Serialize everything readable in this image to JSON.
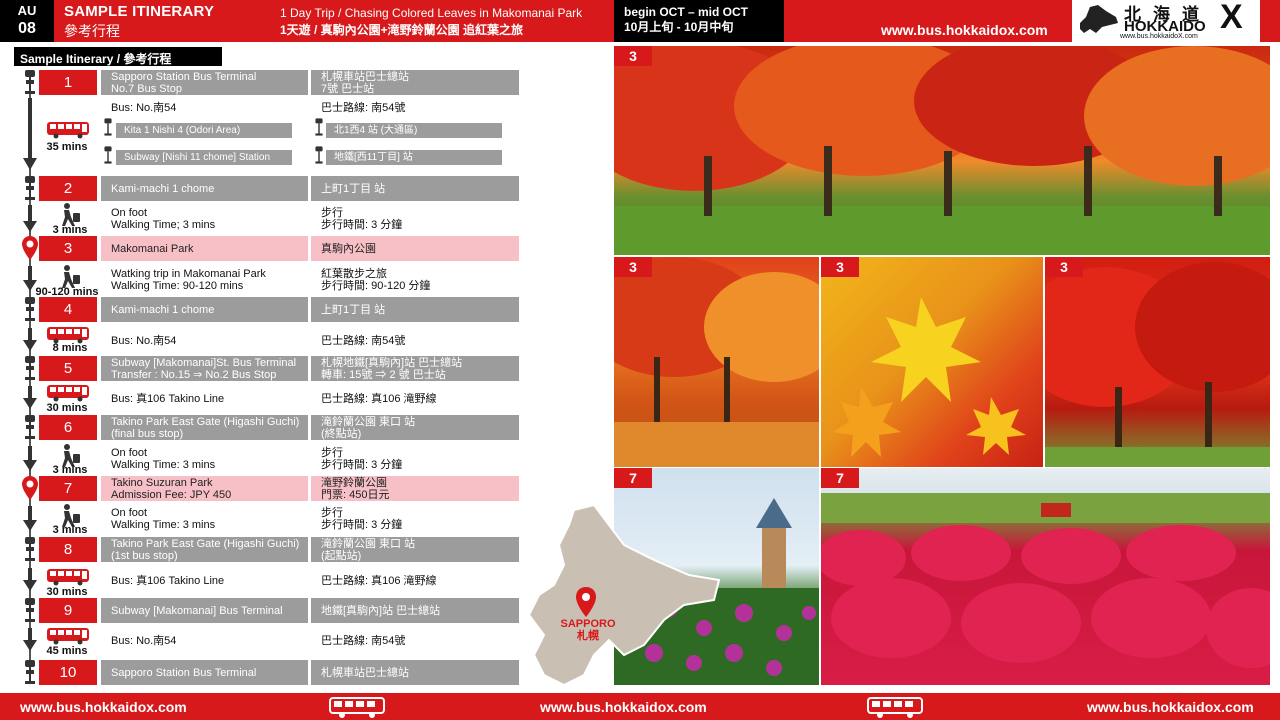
{
  "header": {
    "code_line1": "AU",
    "code_line2": "08",
    "title_en": "SAMPLE ITINERARY",
    "title_zh": "參考行程",
    "trip_en": "1 Day Trip / Chasing Colored Leaves in Makomanai Park",
    "trip_zh": "1天遊 / 真駒內公園+滝野鈴蘭公園 追紅葉之旅",
    "season_en": "begin OCT – mid OCT",
    "season_zh": "10月上旬 - 10月中旬",
    "website": "www.bus.hokkaidox.com",
    "logo_zh": "北海道",
    "logo_en": "HOKKAIDO",
    "logo_x": "X",
    "logo_url": "www.bus.hokkaidoX.com"
  },
  "section_label": "Sample Itinerary / 參考行程",
  "steps": [
    {
      "num": "1",
      "en1": "Sapporo Station Bus Terminal",
      "en2": "No.7 Bus Stop",
      "zh1": "札幌車站巴士總站",
      "zh2": "7號 巴士站",
      "style": "gray"
    },
    {
      "num": "2",
      "en1": "Kami-machi 1 chome",
      "en2": "",
      "zh1": "上町1丁目 站",
      "zh2": "",
      "style": "gray"
    },
    {
      "num": "3",
      "en1": "Makomanai Park",
      "en2": "",
      "zh1": "真駒內公園",
      "zh2": "",
      "style": "pink"
    },
    {
      "num": "4",
      "en1": "Kami-machi 1 chome",
      "en2": "",
      "zh1": "上町1丁目 站",
      "zh2": "",
      "style": "gray"
    },
    {
      "num": "5",
      "en1": "Subway [Makomanai]St. Bus Terminal",
      "en2": "Transfer : No.15 ⇒ No.2 Bus Stop",
      "zh1": "札幌地鐵[真駒內]站 巴士總站",
      "zh2": "轉車: 15號 ⇒ 2 號 巴士站",
      "style": "gray"
    },
    {
      "num": "6",
      "en1": "Takino Park  East Gate (Higashi Guchi)",
      "en2": "(final bus stop)",
      "zh1": "滝鈴蘭公園 東口 站",
      "zh2": "(終點站)",
      "style": "gray"
    },
    {
      "num": "7",
      "en1": "Takino Suzuran Park",
      "en2": "Admission Fee: JPY 450",
      "zh1": "滝野鈴蘭公園",
      "zh2": "門票: 450日元",
      "style": "pink"
    },
    {
      "num": "8",
      "en1": "Takino Park  East Gate (Higashi Guchi)",
      "en2": "(1st bus stop)",
      "zh1": "滝鈴蘭公園 東口 站",
      "zh2": "(起點站)",
      "style": "gray"
    },
    {
      "num": "9",
      "en1": "Subway [Makomanai] Bus Terminal",
      "en2": "",
      "zh1": "地鐵[真駒內]站 巴士總站",
      "zh2": "",
      "style": "gray"
    },
    {
      "num": "10",
      "en1": "Sapporo Station Bus Terminal",
      "en2": "",
      "zh1": "札幌車站巴士總站",
      "zh2": "",
      "style": "gray"
    }
  ],
  "legs": [
    {
      "mode": "bus",
      "mins": "35 mins",
      "en1": "Bus: No.南54",
      "en2": "",
      "zh1": "巴士路線: 南54號",
      "zh2": "",
      "via": [
        {
          "en": "Kita 1 Nishi 4  (Odori Area)",
          "zh": "北1西4 站 (大通區)"
        },
        {
          "en": "Subway [Nishi 11 chome] Station",
          "zh": "地鐵[西11丁目] 站"
        }
      ]
    },
    {
      "mode": "walk",
      "mins": "3 mins",
      "en1": "On foot",
      "en2": "Walking Time;  3 mins",
      "zh1": "步行",
      "zh2": "步行時間: 3 分鐘"
    },
    {
      "mode": "walk",
      "mins": "90-120 mins",
      "en1": "Watking trip in  Makomanai  Park",
      "en2": "Walking Time:  90-120 mins",
      "zh1": "紅葉散步之旅",
      "zh2": "步行時間: 90-120 分鐘"
    },
    {
      "mode": "bus",
      "mins": "8 mins",
      "en1": "Bus: No.南54",
      "en2": "",
      "zh1": "巴士路線: 南54號",
      "zh2": ""
    },
    {
      "mode": "bus",
      "mins": "30 mins",
      "en1": "Bus: 真106 Takino Line",
      "en2": "",
      "zh1": "巴士路線: 真106 滝野線",
      "zh2": ""
    },
    {
      "mode": "walk",
      "mins": "3 mins",
      "en1": "On foot",
      "en2": "Walking Time:  3 mins",
      "zh1": "步行",
      "zh2": "步行時間: 3 分鐘"
    },
    {
      "mode": "walk",
      "mins": "3 mins",
      "en1": "On foot",
      "en2": "Walking Time:  3 mins",
      "zh1": "步行",
      "zh2": "步行時間: 3 分鐘"
    },
    {
      "mode": "bus",
      "mins": "30 mins",
      "en1": "Bus: 真106 Takino Line",
      "en2": "",
      "zh1": "巴士路線: 真106 滝野線",
      "zh2": ""
    },
    {
      "mode": "bus",
      "mins": "45 mins",
      "en1": "Bus: No.南54",
      "en2": "",
      "zh1": "巴士路線: 南54號",
      "zh2": ""
    }
  ],
  "photos": [
    {
      "num": "3"
    },
    {
      "num": "3"
    },
    {
      "num": "3"
    },
    {
      "num": "3"
    },
    {
      "num": "7"
    },
    {
      "num": "7"
    }
  ],
  "map": {
    "label_en": "SAPPORO",
    "label_zh": "札幌"
  },
  "footer": {
    "url": "www.bus.hokkaidox.com"
  },
  "colors": {
    "accent": "#d7191c",
    "gray_cell": "#9c9c9c",
    "pink_cell": "#f6c0c6"
  },
  "icons": [
    "bus-stop-icon",
    "location-pin-icon",
    "down-arrow-icon",
    "bus-icon",
    "walking-person-icon"
  ]
}
